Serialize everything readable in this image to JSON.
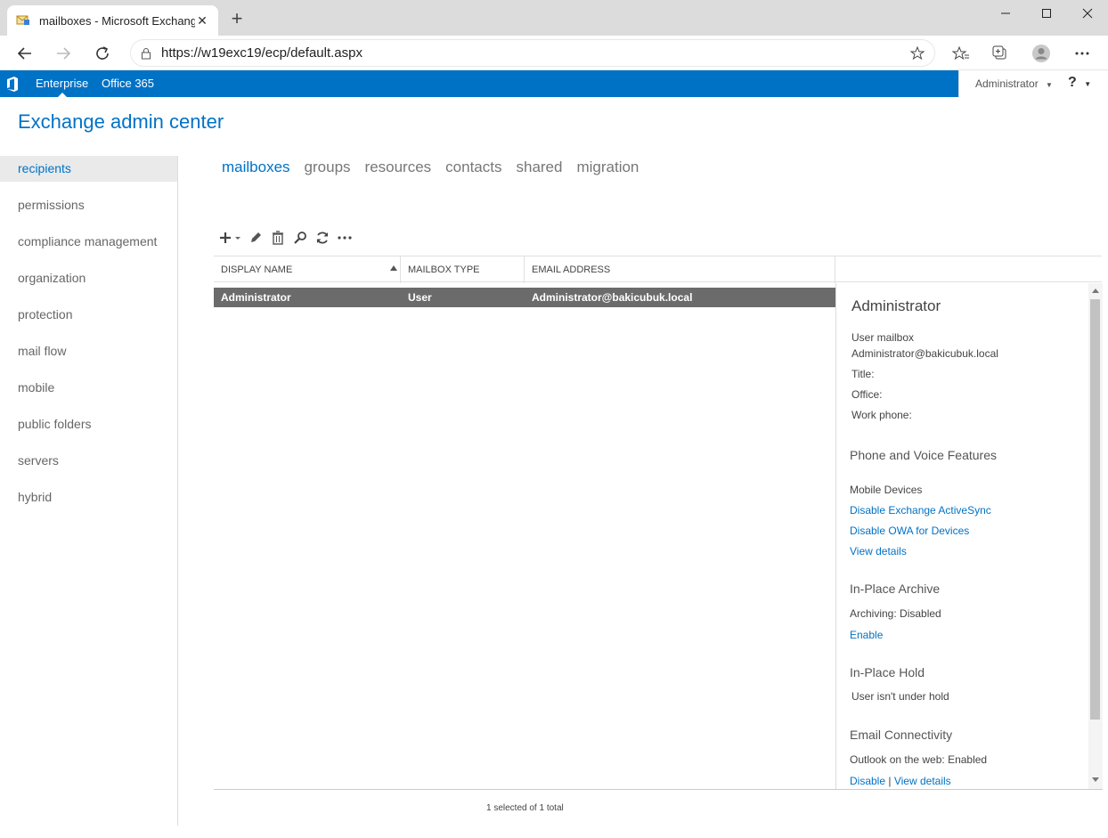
{
  "browser": {
    "tab_title": "mailboxes - Microsoft Exchange",
    "url": "https://w19exc19/ecp/default.aspx"
  },
  "topbar": {
    "enterprise": "Enterprise",
    "office365": "Office 365",
    "user": "Administrator",
    "help": "?"
  },
  "app_title": "Exchange admin center",
  "nav": [
    {
      "label": "recipients"
    },
    {
      "label": "permissions"
    },
    {
      "label": "compliance management"
    },
    {
      "label": "organization"
    },
    {
      "label": "protection"
    },
    {
      "label": "mail flow"
    },
    {
      "label": "mobile"
    },
    {
      "label": "public folders"
    },
    {
      "label": "servers"
    },
    {
      "label": "hybrid"
    }
  ],
  "tabs": [
    {
      "label": "mailboxes"
    },
    {
      "label": "groups"
    },
    {
      "label": "resources"
    },
    {
      "label": "contacts"
    },
    {
      "label": "shared"
    },
    {
      "label": "migration"
    }
  ],
  "grid": {
    "columns": [
      "DISPLAY NAME",
      "MAILBOX TYPE",
      "EMAIL ADDRESS"
    ],
    "rows": [
      [
        "Administrator",
        "User",
        "Administrator@bakicubuk.local"
      ]
    ],
    "status": "1 selected of 1 total"
  },
  "details": {
    "name": "Administrator",
    "type": "User mailbox",
    "email": "Administrator@bakicubuk.local",
    "title_label": "Title:",
    "office_label": "Office:",
    "work_phone_label": "Work phone:",
    "phone_voice_heading": "Phone and Voice Features",
    "mobile_devices": "Mobile Devices",
    "disable_activesync": "Disable Exchange ActiveSync",
    "disable_owa_devices": "Disable OWA for Devices",
    "view_details": "View details",
    "archive_heading": "In-Place Archive",
    "archiving": "Archiving:  Disabled",
    "enable": "Enable",
    "hold_heading": "In-Place Hold",
    "hold_status": "User isn't under hold",
    "email_conn_heading": "Email Connectivity",
    "owa_status": "Outlook on the web:  Enabled",
    "disable": "Disable",
    "separator": "|",
    "view_details2": "View details"
  },
  "colors": {
    "accent": "#0072c6",
    "selected_row": "#6b6b6b"
  }
}
